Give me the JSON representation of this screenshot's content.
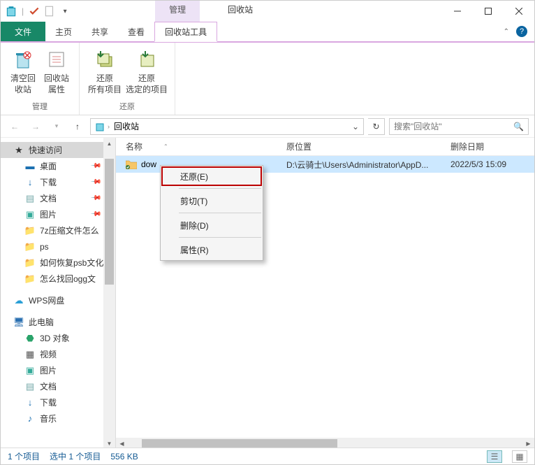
{
  "titlebar": {
    "manage_tab": "管理",
    "window_title": "回收站"
  },
  "ribbon_tabs": {
    "file": "文件",
    "home": "主页",
    "share": "共享",
    "view": "查看",
    "recycle_tools": "回收站工具"
  },
  "ribbon": {
    "group_manage": "管理",
    "group_restore": "还原",
    "btn_empty1": "清空回",
    "btn_empty2": "收站",
    "btn_props1": "回收站",
    "btn_props2": "属性",
    "btn_restore_all1": "还原",
    "btn_restore_all2": "所有项目",
    "btn_restore_sel1": "还原",
    "btn_restore_sel2": "选定的项目"
  },
  "address": {
    "location": "回收站",
    "search_placeholder": "搜索\"回收站\""
  },
  "columns": {
    "name": "名称",
    "location": "原位置",
    "deleted": "删除日期"
  },
  "files": [
    {
      "name": "dow",
      "location": "D:\\云骑士\\Users\\Administrator\\AppD...",
      "deleted": "2022/5/3 15:09"
    }
  ],
  "sidebar": {
    "quick": "快速访问",
    "desktop": "桌面",
    "downloads": "下载",
    "documents": "文档",
    "pictures": "图片",
    "folder_7z": "7z压缩文件怎么",
    "folder_ps": "ps",
    "folder_psb": "如何恢复psb文化",
    "folder_ogg": "怎么找回ogg文",
    "wps": "WPS网盘",
    "thispc": "此电脑",
    "obj3d": "3D 对象",
    "videos": "视频",
    "pictures2": "图片",
    "documents2": "文档",
    "downloads2": "下载",
    "music": "音乐"
  },
  "context_menu": {
    "restore": "还原(E)",
    "cut": "剪切(T)",
    "delete": "删除(D)",
    "properties": "属性(R)"
  },
  "status": {
    "count": "1 个项目",
    "selected": "选中 1 个项目",
    "size": "556 KB"
  }
}
